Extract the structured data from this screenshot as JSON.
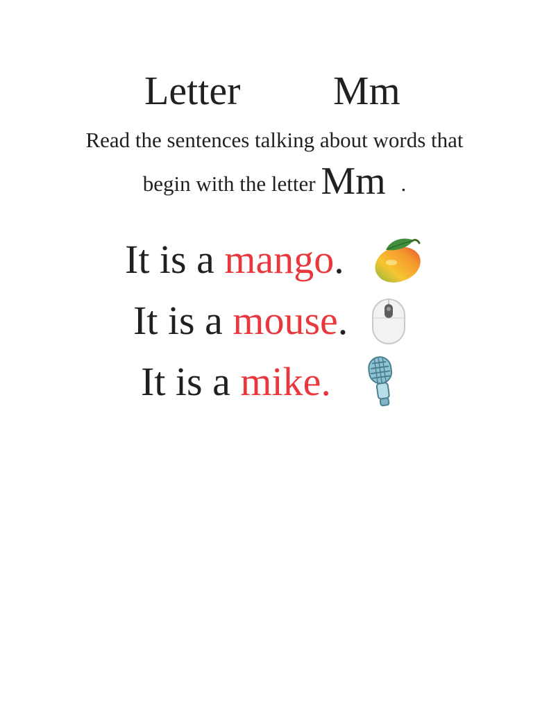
{
  "title": {
    "word_letter": "Letter",
    "word_mm": "Mm"
  },
  "instructions": {
    "line1": "Read the sentences talking about words that",
    "line2_prefix": "begin with the letter",
    "line2_letter": "Mm",
    "line2_suffix": "."
  },
  "sentences": [
    {
      "prefix": "It is a ",
      "word": "mango",
      "suffix": ".",
      "icon": "mango-icon"
    },
    {
      "prefix": "It is a ",
      "word": "mouse",
      "suffix": ".",
      "icon": "computer-mouse-icon"
    },
    {
      "prefix": "It is a ",
      "word": "mike.",
      "suffix": "",
      "icon": "microphone-icon"
    }
  ],
  "colors": {
    "text": "#231f20",
    "highlight": "#e8383d"
  }
}
